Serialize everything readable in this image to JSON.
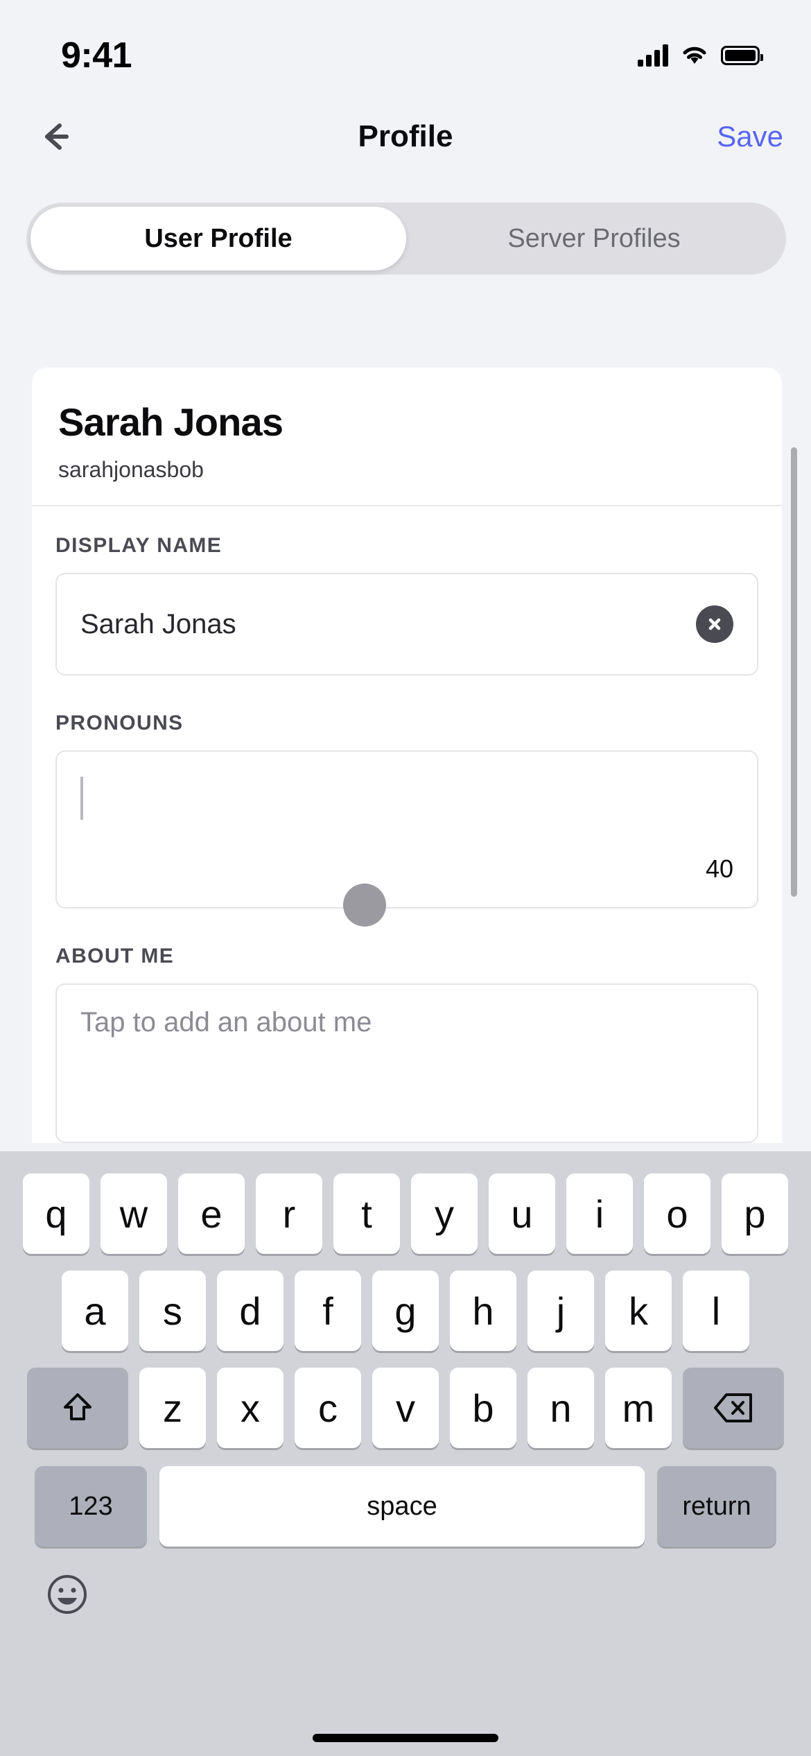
{
  "status_bar": {
    "time": "9:41",
    "cellular_icon": "signal-bars-icon",
    "wifi_icon": "wifi-icon",
    "battery_icon": "battery-full-icon"
  },
  "nav": {
    "back_icon": "arrow-left-icon",
    "title": "Profile",
    "save_label": "Save",
    "save_color": "#5865F2"
  },
  "tabs": [
    {
      "label": "User Profile",
      "active": true
    },
    {
      "label": "Server Profiles",
      "active": false
    }
  ],
  "profile": {
    "display_name": "Sarah Jonas",
    "username": "sarahjonasbob"
  },
  "fields": {
    "display_name": {
      "label": "DISPLAY NAME",
      "value": "Sarah Jonas",
      "clear_icon": "close-circle-icon"
    },
    "pronouns": {
      "label": "PRONOUNS",
      "value": "",
      "placeholder": "",
      "char_counter": "40"
    },
    "about_me": {
      "label": "ABOUT ME",
      "value": "",
      "placeholder": "Tap to add an about me"
    }
  },
  "keyboard": {
    "row1": [
      "q",
      "w",
      "e",
      "r",
      "t",
      "y",
      "u",
      "i",
      "o",
      "p"
    ],
    "row2": [
      "a",
      "s",
      "d",
      "f",
      "g",
      "h",
      "j",
      "k",
      "l"
    ],
    "row3": [
      "z",
      "x",
      "c",
      "v",
      "b",
      "n",
      "m"
    ],
    "shift_icon": "shift-up-arrow-icon",
    "backspace_icon": "backspace-delete-icon",
    "numbers_label": "123",
    "space_label": "space",
    "return_label": "return",
    "emoji_icon": "emoji-smiley-icon"
  }
}
